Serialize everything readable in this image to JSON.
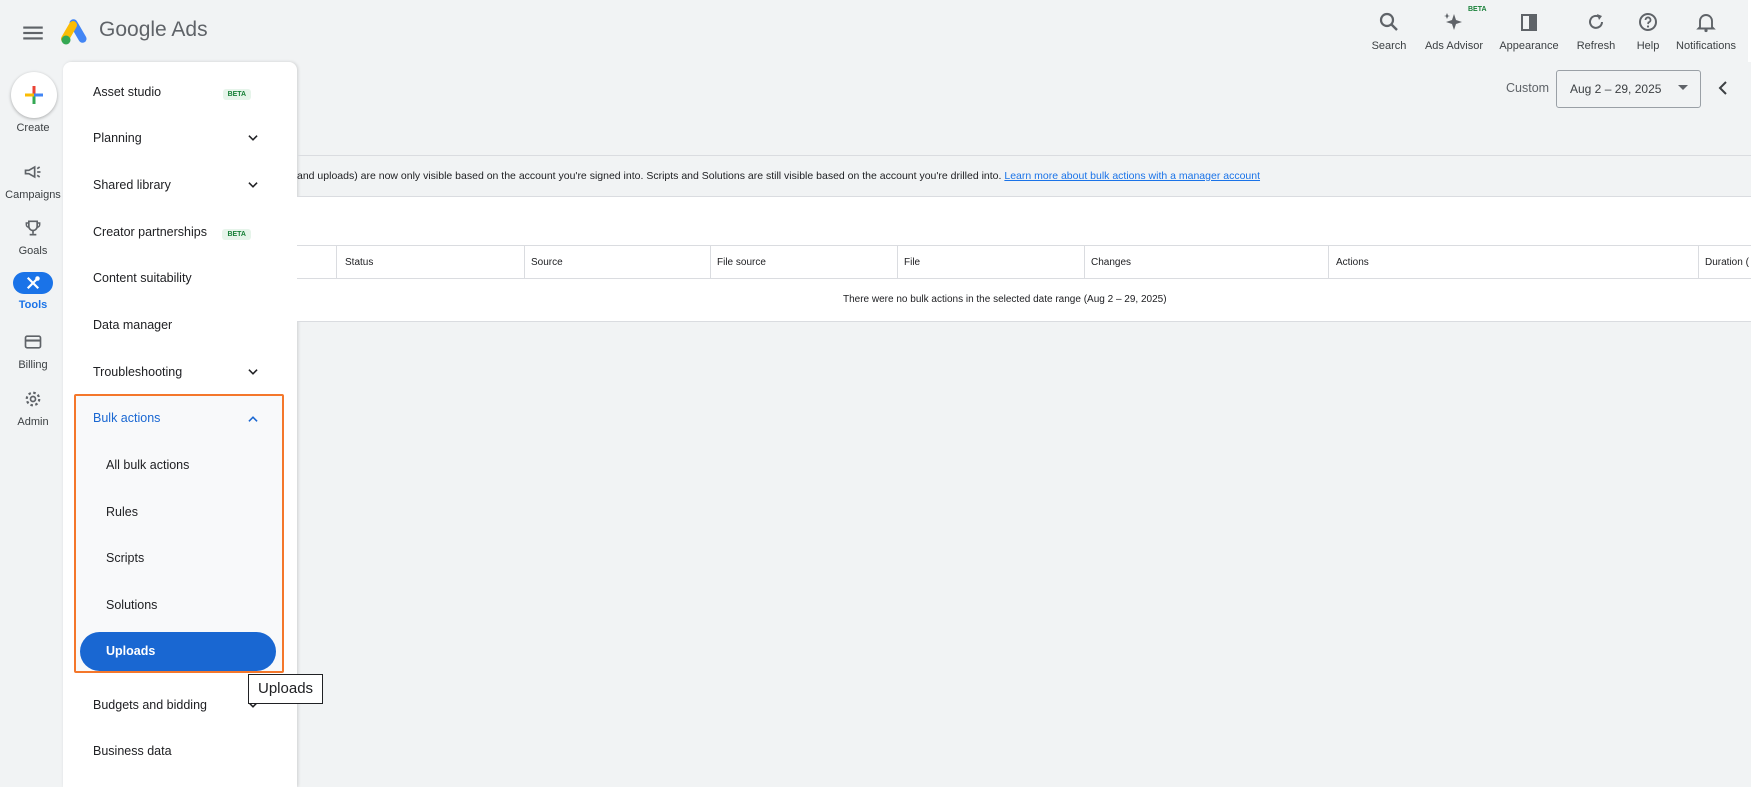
{
  "app": {
    "brand": "Google Ads"
  },
  "toolbar": [
    {
      "label": "Search",
      "icon": "search-icon"
    },
    {
      "label": "Ads Advisor",
      "icon": "sparkle-icon",
      "badge": "BETA"
    },
    {
      "label": "Appearance",
      "icon": "appearance-icon"
    },
    {
      "label": "Refresh",
      "icon": "refresh-icon"
    },
    {
      "label": "Help",
      "icon": "help-icon"
    },
    {
      "label": "Notifications",
      "icon": "bell-icon"
    }
  ],
  "rail": [
    {
      "label": "Create",
      "icon": "plus-icon"
    },
    {
      "label": "Campaigns",
      "icon": "megaphone-icon"
    },
    {
      "label": "Goals",
      "icon": "trophy-icon"
    },
    {
      "label": "Tools",
      "icon": "tools-icon",
      "active": true
    },
    {
      "label": "Billing",
      "icon": "card-icon"
    },
    {
      "label": "Admin",
      "icon": "gear-icon"
    }
  ],
  "drawer": {
    "items": [
      {
        "label": "Asset studio",
        "badge": "BETA"
      },
      {
        "label": "Planning",
        "expandable": true
      },
      {
        "label": "Shared library",
        "expandable": true
      },
      {
        "label": "Creator partnerships",
        "badge": "BETA"
      },
      {
        "label": "Content suitability"
      },
      {
        "label": "Data manager"
      },
      {
        "label": "Troubleshooting",
        "expandable": true
      },
      {
        "label": "Bulk actions",
        "expanded": true
      },
      {
        "label": "Budgets and bidding",
        "expandable": true
      },
      {
        "label": "Business data"
      }
    ],
    "bulk_sub": [
      "All bulk actions",
      "Rules",
      "Scripts",
      "Solutions",
      "Uploads"
    ],
    "selected": "Uploads"
  },
  "tooltip": "Uploads",
  "date": {
    "label": "Custom",
    "range": "Aug 2 – 29, 2025"
  },
  "notice": {
    "text": "and uploads) are now only visible based on the account you're signed into. Scripts and Solutions are still visible based on the account you're drilled into. ",
    "link": "Learn more about bulk actions with a manager account"
  },
  "table": {
    "columns": [
      "Status",
      "Source",
      "File source",
      "File",
      "Changes",
      "Actions",
      "Duration ("
    ],
    "empty_message": "There were no bulk actions in the selected date range (Aug 2 – 29, 2025)"
  },
  "colors": {
    "accent": "#1a73e8",
    "highlight": "#f4772b",
    "beta": "#188038"
  }
}
